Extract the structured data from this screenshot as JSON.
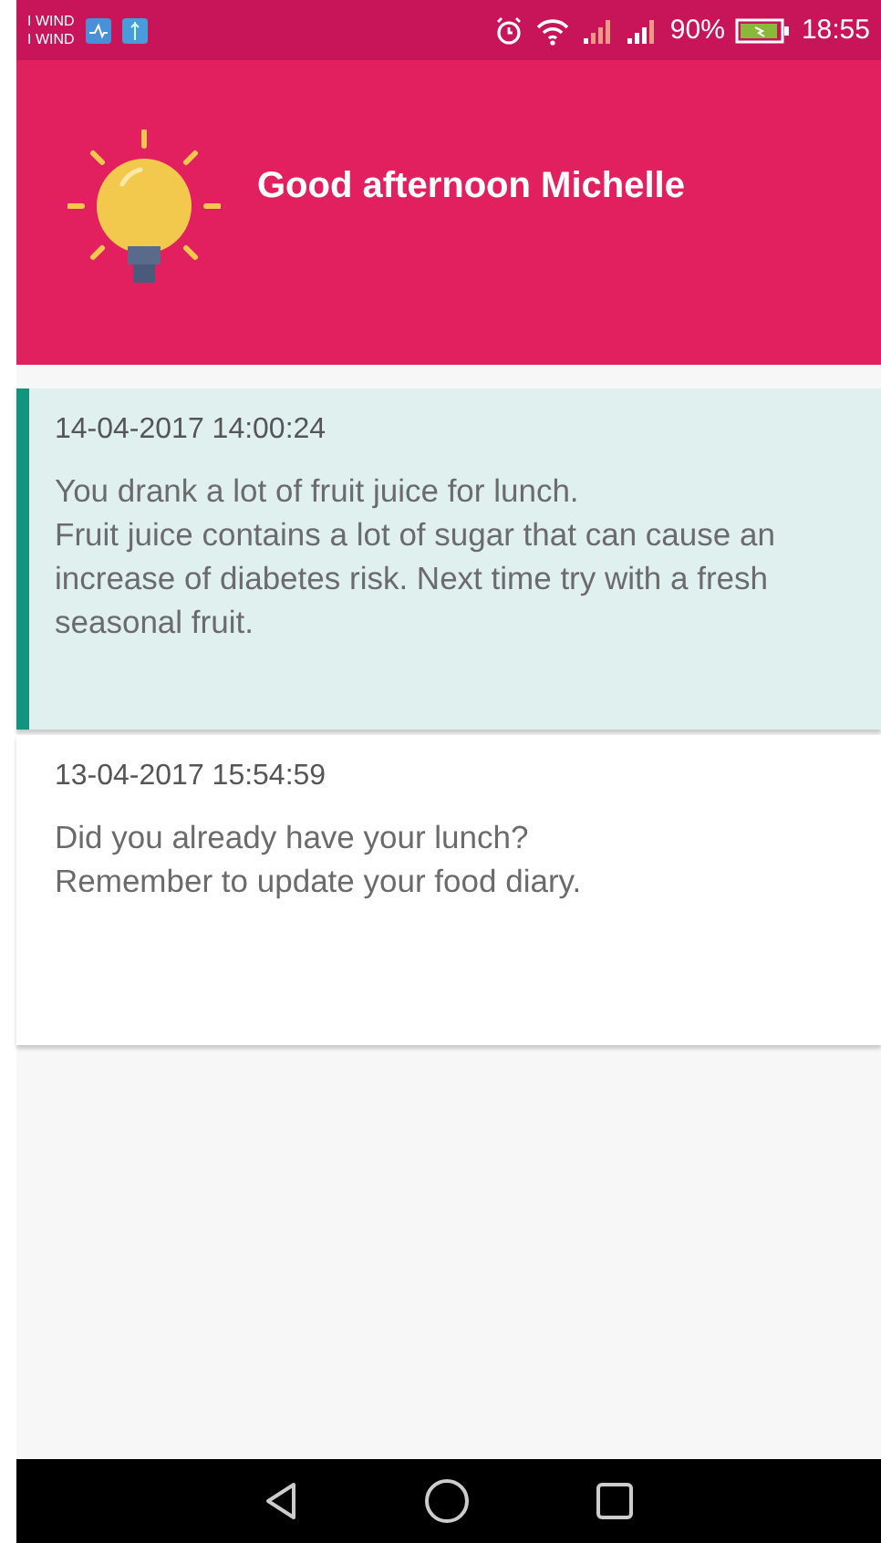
{
  "status_bar": {
    "carriers": [
      "I WIND",
      "I WIND"
    ],
    "battery": "90%",
    "time": "18:55"
  },
  "header": {
    "greeting": "Good afternoon Michelle"
  },
  "messages": [
    {
      "timestamp": "14-04-2017 14:00:24",
      "text": "You drank a lot of fruit juice for lunch.\nFruit juice contains a lot of sugar that can cause an increase of diabetes risk. Next time try with a fresh seasonal fruit.",
      "unread": true
    },
    {
      "timestamp": "13-04-2017 15:54:59",
      "text": "Did you already have your lunch?\nRemember to update your food diary.",
      "unread": false
    }
  ]
}
